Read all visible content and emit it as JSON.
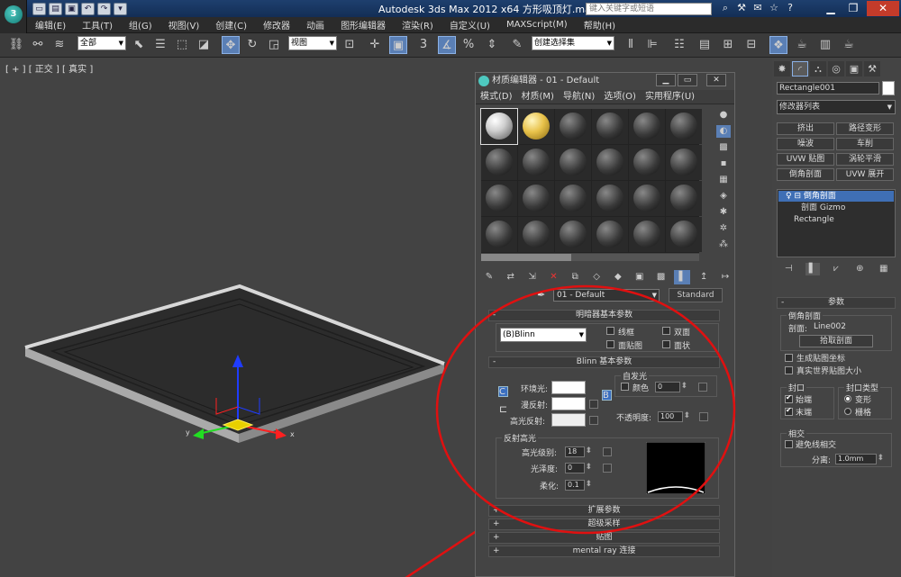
{
  "titlebar": {
    "app_title": "Autodesk 3ds Max  2012 x64    方形吸顶灯.max",
    "search_placeholder": "键入关键字或短语"
  },
  "menubar": [
    "编辑(E)",
    "工具(T)",
    "组(G)",
    "视图(V)",
    "创建(C)",
    "修改器",
    "动画",
    "图形编辑器",
    "渲染(R)",
    "自定义(U)",
    "MAXScript(M)",
    "帮助(H)"
  ],
  "toolbar": {
    "selection_filter": "全部",
    "ref_coord": "视图",
    "snap_angle": "3",
    "named_selection": "创建选择集"
  },
  "viewport": {
    "label": "[ + ] [ 正交 ] [ 真实 ]"
  },
  "material_editor": {
    "title": "材质编辑器 - 01 - Default",
    "menu": [
      "模式(D)",
      "材质(M)",
      "导航(N)",
      "选项(O)",
      "实用程序(U)"
    ],
    "material_name": "01 - Default",
    "material_type": "Standard",
    "shader_rollout": {
      "title": "明暗器基本参数",
      "shader": "(B)Blinn",
      "wire": "线框",
      "two_sided": "双面",
      "face_map": "面贴图",
      "faceted": "面状"
    },
    "blinn_rollout": {
      "title": "Blinn 基本参数",
      "self_illum_group": "自发光",
      "color_label": "颜色",
      "color_value": "0",
      "ambient": "环境光:",
      "diffuse": "漫反射:",
      "specular": "高光反射:",
      "opacity_label": "不透明度:",
      "opacity_value": "100",
      "lock_c": "C",
      "lock_b": "B"
    },
    "spec_group": {
      "title": "反射高光",
      "spec_level_label": "高光级别:",
      "spec_level_value": "18",
      "glossiness_label": "光泽度:",
      "glossiness_value": "0",
      "soften_label": "柔化:",
      "soften_value": "0.1"
    },
    "rollouts": [
      "扩展参数",
      "超级采样",
      "贴图",
      "mental ray 连接"
    ]
  },
  "command_panel": {
    "object_name": "Rectangle001",
    "modifier_list": "修改器列表",
    "modifier_buttons": [
      "挤出",
      "路径变形",
      "噪波",
      "车削",
      "UVW 贴图",
      "涡轮平滑",
      "倒角剖面",
      "UVW 展开"
    ],
    "stack": [
      "倒角剖面",
      "剖面 Gizmo",
      "Rectangle"
    ],
    "params": {
      "title": "参数",
      "bevel_profile": "倒角剖面",
      "profile_label": "剖面:",
      "profile_value": "Line002",
      "pick_profile": "拾取剖面",
      "gen_mapping": "生成贴图坐标",
      "real_world": "真实世界贴图大小",
      "cap_group": "封口",
      "cap_start": "始端",
      "cap_end": "末端",
      "cap_type_group": "封口类型",
      "morph": "变形",
      "grid": "栅格",
      "intersect_group": "相交",
      "avoid_intersect": "避免线相交",
      "separation_label": "分离:",
      "separation_value": "1.0mm"
    }
  }
}
